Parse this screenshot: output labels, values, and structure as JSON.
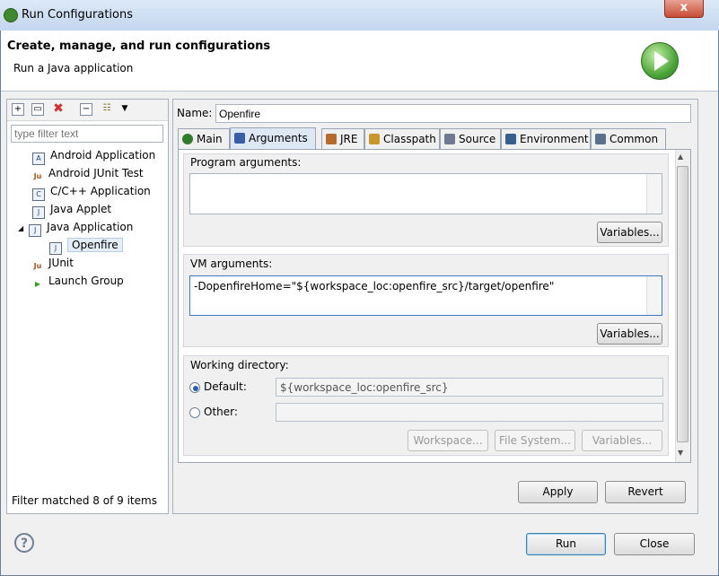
{
  "window": {
    "title": "Run Configurations",
    "close_glyph": "x"
  },
  "header": {
    "title": "Create, manage, and run configurations",
    "subtitle": "Run a Java application"
  },
  "left": {
    "filter_placeholder": "type filter text",
    "toolbar_icons": [
      "new-launch-config-icon",
      "duplicate-icon",
      "delete-icon",
      "collapse-all-icon",
      "filter-icon",
      "dropdown-icon"
    ],
    "tree": [
      {
        "label": "Android Application",
        "icon": "A"
      },
      {
        "label": "Android JUnit Test",
        "icon": "Ju"
      },
      {
        "label": "C/C++ Application",
        "icon": "C"
      },
      {
        "label": "Java Applet",
        "icon": "J"
      },
      {
        "label": "Java Application",
        "icon": "J",
        "expand": "◢"
      },
      {
        "label": "Openfire",
        "icon": "J",
        "selected": true
      },
      {
        "label": "JUnit",
        "icon": "Ju"
      },
      {
        "label": "Launch Group",
        "icon": "▶"
      }
    ],
    "status": "Filter matched 8 of 9 items"
  },
  "right": {
    "name_label": "Name:",
    "name_value": "Openfire",
    "tabs": [
      {
        "label": "Main",
        "icon": "main-tab-icon",
        "color": "#2f7d2a"
      },
      {
        "label": "Arguments",
        "icon": "arguments-tab-icon",
        "color": "#3a5da8",
        "active": true
      },
      {
        "label": "JRE",
        "icon": "jre-tab-icon",
        "color": "#b56b2c"
      },
      {
        "label": "Classpath",
        "icon": "classpath-tab-icon",
        "color": "#c8962a"
      },
      {
        "label": "Source",
        "icon": "source-tab-icon",
        "color": "#6d7a8f"
      },
      {
        "label": "Environment",
        "icon": "environment-tab-icon",
        "color": "#35608e"
      },
      {
        "label": "Common",
        "icon": "common-tab-icon",
        "color": "#5a6f8c"
      }
    ],
    "program_args": {
      "title": "Program arguments:",
      "value": "",
      "variables_button": "Variables..."
    },
    "vm_args": {
      "title": "VM arguments:",
      "value": "-DopenfireHome=\"${workspace_loc:openfire_src}/target/openfire\"",
      "variables_button": "Variables..."
    },
    "working_dir": {
      "title": "Working directory:",
      "default_label": "Default:",
      "default_value": "${workspace_loc:openfire_src}",
      "other_label": "Other:",
      "other_value": "",
      "workspace_button": "Workspace...",
      "filesystem_button": "File System...",
      "variables_button": "Variables..."
    },
    "apply_button": "Apply",
    "revert_button": "Revert"
  },
  "footer": {
    "help_glyph": "?",
    "run_button": "Run",
    "close_button": "Close"
  }
}
